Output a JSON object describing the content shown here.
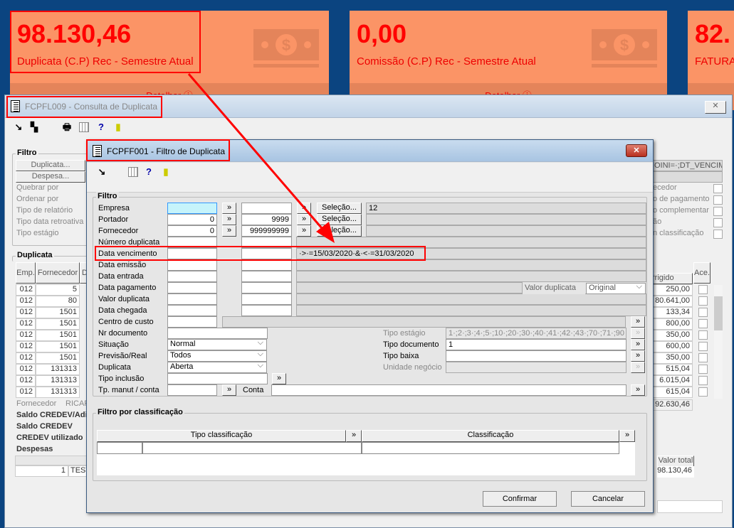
{
  "cards": [
    {
      "value": "98.130,46",
      "label": "Duplicata (C.P) Rec - Semestre Atual",
      "link": "Detalhar"
    },
    {
      "value": "0,00",
      "label": "Comissão (C.P) Rec - Semestre Atual",
      "link": "Detalhar"
    },
    {
      "value": "82.",
      "label": "FATURA",
      "link": ""
    }
  ],
  "back": {
    "title": "FCPFL009 - Consulta de Duplicata",
    "filter_title": "Filtro",
    "btn_dup": "Duplicata...",
    "btn_desp": "Despesa...",
    "labels": [
      "Quebrar por",
      "Ordenar por",
      "Tipo de relatório",
      "Tipo data retroativa",
      "Tipo estágio"
    ],
    "right_field": "OINI=·;DT_VENCIME",
    "right_labels": [
      "ecedor",
      "o de pagamento",
      "o complementar",
      "ão",
      "n classificação"
    ],
    "dup_title": "Duplicata",
    "cols": [
      "Emp.",
      "Fornecedor",
      "D"
    ],
    "col_right": "rrigido",
    "col_ace": "Ace.",
    "rows": [
      [
        "012",
        "5",
        "250,00"
      ],
      [
        "012",
        "80",
        "80.641,00"
      ],
      [
        "012",
        "1501",
        "133,34"
      ],
      [
        "012",
        "1501",
        "800,00"
      ],
      [
        "012",
        "1501",
        "350,00"
      ],
      [
        "012",
        "1501",
        "600,00"
      ],
      [
        "012",
        "1501",
        "350,00"
      ],
      [
        "012",
        "131313",
        "515,04"
      ],
      [
        "012",
        "131313",
        "6.015,04"
      ],
      [
        "012",
        "131313",
        "615,04"
      ]
    ],
    "total": "92.630,46",
    "fornecedor_label": "Fornecedor",
    "fornecedor_value": "RICAR",
    "saldo_title": "Saldo CREDEV/Adia",
    "saldo_credev": "Saldo CREDEV",
    "credev_utilizado": "CREDEV utilizado",
    "despesas_title": "Despesas",
    "desp_row": [
      "1",
      "TESTE"
    ],
    "valor_total_header": "Valor total",
    "valor_total": "98.130,46"
  },
  "dialog": {
    "title": "FCPFF001 - Filtro de Duplicata",
    "filter_title": "Filtro",
    "range_rows": [
      {
        "label": "Empresa",
        "from": "",
        "to": "",
        "sel": "Seleção...",
        "extra": "12"
      },
      {
        "label": "Portador",
        "from": "0",
        "to": "9999",
        "sel": "Seleção...",
        "extra": ""
      },
      {
        "label": "Fornecedor",
        "from": "0",
        "to": "999999999",
        "sel": "Seleção...",
        "extra": ""
      },
      {
        "label": "Número duplicata",
        "from": "",
        "to": "",
        "extra": ""
      },
      {
        "label": "Data vencimento",
        "from": "",
        "to": "",
        "extra": "·>·=15/03/2020·&·<·=31/03/2020"
      },
      {
        "label": "Data emissão",
        "from": "",
        "to": "",
        "extra": ""
      },
      {
        "label": "Data entrada",
        "from": "",
        "to": "",
        "extra": ""
      },
      {
        "label": "Data pagamento",
        "from": "",
        "to": "",
        "extra": ""
      },
      {
        "label": "Valor duplicata",
        "from": "",
        "to": "",
        "extra": ""
      },
      {
        "label": "Data chegada",
        "from": "",
        "to": "",
        "extra": ""
      }
    ],
    "valor_dup_label": "Valor duplicata",
    "valor_dup_value": "Original",
    "centro_custo": "Centro de custo",
    "nr_documento": "Nr documento",
    "situacao": "Situação",
    "situacao_value": "Normal",
    "previsao": "Previsão/Real",
    "previsao_value": "Todos",
    "duplicata": "Duplicata",
    "duplicata_value": "Aberta",
    "tipo_inclusao": "Tipo inclusão",
    "tp_manut": "Tp. manut / conta",
    "conta": "Conta",
    "tipo_estagio": "Tipo estágio",
    "tipo_estagio_value": "1·;2·;3·;4·;5·;10·;20·;30·;40·;41·;42·;43·;70·;71·;90",
    "tipo_documento": "Tipo documento",
    "tipo_documento_value": "1",
    "tipo_baixa": "Tipo baixa",
    "unidade_negocio": "Unidade negócio",
    "class_title": "Filtro por classificação",
    "class_cols": [
      "Tipo classificação",
      "Classificação"
    ],
    "arrow_btn": "»",
    "confirm": "Confirmar",
    "cancel": "Cancelar"
  },
  "colors": {
    "card": "#fb9466",
    "highlight": "#ff0000",
    "background": "#0b4480"
  }
}
